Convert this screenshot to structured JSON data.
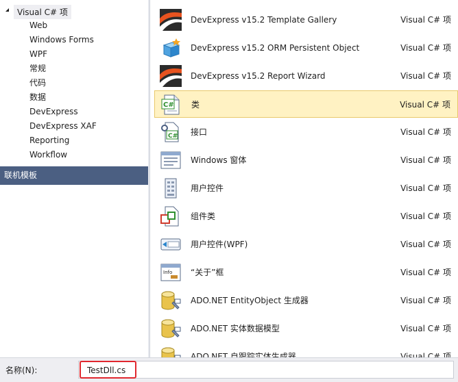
{
  "tree": {
    "root_label": "Visual C# 项",
    "items": [
      "Web",
      "Windows Forms",
      "WPF",
      "常规",
      "代码",
      "数据",
      "DevExpress",
      "DevExpress XAF",
      "Reporting",
      "Workflow"
    ],
    "online_header": "联机模板"
  },
  "templates": [
    {
      "name": "DevExpress v15.2 Template Gallery",
      "type": "Visual C# 项",
      "icon": "devexpress-logo-icon"
    },
    {
      "name": "DevExpress v15.2 ORM Persistent Object",
      "type": "Visual C# 项",
      "icon": "orm-cube-icon"
    },
    {
      "name": "DevExpress v15.2 Report Wizard",
      "type": "Visual C# 项",
      "icon": "devexpress-logo-icon"
    },
    {
      "name": "类",
      "type": "Visual C# 项",
      "icon": "csharp-class-file-icon",
      "selected": true
    },
    {
      "name": "接口",
      "type": "Visual C# 项",
      "icon": "csharp-interface-icon"
    },
    {
      "name": "Windows 窗体",
      "type": "Visual C# 项",
      "icon": "windows-form-icon"
    },
    {
      "name": "用户控件",
      "type": "Visual C# 项",
      "icon": "user-control-icon"
    },
    {
      "name": "组件类",
      "type": "Visual C# 项",
      "icon": "component-class-icon"
    },
    {
      "name": "用户控件(WPF)",
      "type": "Visual C# 项",
      "icon": "wpf-user-control-icon"
    },
    {
      "name": "“关于”框",
      "type": "Visual C# 项",
      "icon": "about-box-icon"
    },
    {
      "name": "ADO.NET EntityObject 生成器",
      "type": "Visual C# 项",
      "icon": "database-generator-icon"
    },
    {
      "name": "ADO.NET 实体数据模型",
      "type": "Visual C# 项",
      "icon": "database-generator-icon"
    },
    {
      "name": "ADO.NET 自跟踪实体生成器",
      "type": "Visual C# 项",
      "icon": "database-generator-icon"
    }
  ],
  "name_field": {
    "label": "名称(N):",
    "value": "TestDll.cs"
  },
  "colors": {
    "selected_bg": "#fff2c3",
    "header_bg": "#4b5f82",
    "highlight": "#e0262d"
  }
}
